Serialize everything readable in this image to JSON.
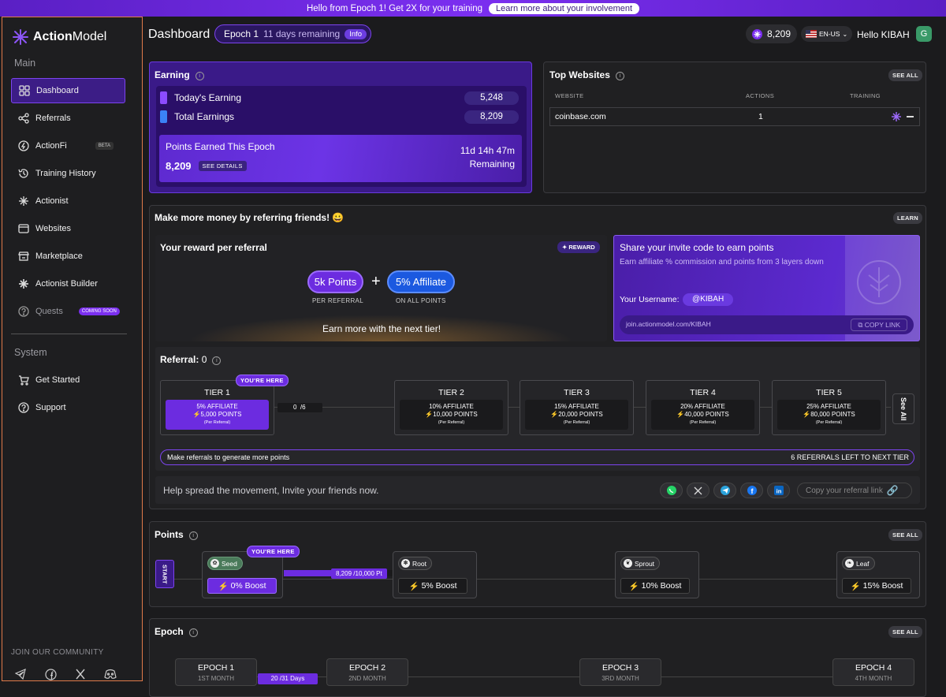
{
  "banner": {
    "message": "Hello from Epoch 1! Get 2X for your training",
    "cta": "Learn more about your involvement"
  },
  "brand": {
    "name_bold": "Action",
    "name_rest": "Model"
  },
  "sidebar": {
    "main_label": "Main",
    "items": [
      {
        "label": "Dashboard",
        "icon": "grid-icon"
      },
      {
        "label": "Referrals",
        "icon": "share-icon"
      },
      {
        "label": "ActionFi",
        "icon": "bolt-circle-icon",
        "badge": "BETA"
      },
      {
        "label": "Training History",
        "icon": "history-icon"
      },
      {
        "label": "Actionist",
        "icon": "logo-star-icon"
      },
      {
        "label": "Websites",
        "icon": "browser-icon"
      },
      {
        "label": "Marketplace",
        "icon": "store-icon"
      },
      {
        "label": "Actionist Builder",
        "icon": "builder-icon"
      },
      {
        "label": "Quests",
        "icon": "question-icon",
        "badge": "COMING SOON"
      }
    ],
    "system_label": "System",
    "system_items": [
      {
        "label": "Get Started",
        "icon": "cart-icon"
      },
      {
        "label": "Support",
        "icon": "help-icon"
      }
    ],
    "community_label": "JOIN OUR COMMUNITY"
  },
  "topbar": {
    "title": "Dashboard",
    "epoch_label": "Epoch 1",
    "epoch_remaining": "11 days remaining",
    "info_label": "Info",
    "points": "8,209",
    "language": "EN-US",
    "greeting": "Hello KIBAH",
    "avatar_letter": "G"
  },
  "earning": {
    "title": "Earning",
    "today_label": "Today's Earning",
    "today_value": "5,248",
    "total_label": "Total Earnings",
    "total_value": "8,209",
    "epoch_points_label": "Points Earned This Epoch",
    "epoch_points_value": "8,209",
    "see_details": "SEE DETAILS",
    "countdown": "11d 14h 47m",
    "remaining": "Remaining"
  },
  "top_websites": {
    "title": "Top Websites",
    "see_all": "SEE ALL",
    "columns": [
      "WEBSITE",
      "ACTIONS",
      "TRAINING"
    ],
    "rows": [
      {
        "website": "coinbase.com",
        "actions": "1"
      }
    ]
  },
  "referring": {
    "title": "Make more money by referring friends! 😀",
    "learn": "LEARN",
    "reward_title": "Your reward per referral",
    "reward_tag": "REWARD",
    "points_pill": "5k Points",
    "points_caption": "PER REFERRAL",
    "plus": "+",
    "affiliate_pill": "5% Affiliate",
    "affiliate_caption": "ON ALL POINTS",
    "earn_more": "Earn more with the next tier!",
    "share_title": "Share your invite code to earn points",
    "share_desc": "Earn affiliate % commission and points from 3 layers down",
    "username_label": "Your Username:",
    "username": "@KIBAH",
    "invite_link": "join.actionmodel.com/KIBAH",
    "copy_link": "COPY LINK"
  },
  "referral_tiers": {
    "title": "Referral:",
    "count": "0",
    "here": "YOU'RE HERE",
    "progress": "0",
    "progress_total": "/6",
    "see_all": "See All",
    "tiers": [
      {
        "name": "TIER 1",
        "affiliate": "5% AFFILIATE",
        "points": "5,000 POINTS",
        "note": "(Per Referral)"
      },
      {
        "name": "TIER 2",
        "affiliate": "10% AFFILIATE",
        "points": "10,000 POINTS",
        "note": "(Per Referral)"
      },
      {
        "name": "TIER 3",
        "affiliate": "15% AFFILIATE",
        "points": "20,000 POINTS",
        "note": "(Per Referral)"
      },
      {
        "name": "TIER 4",
        "affiliate": "20% AFFILIATE",
        "points": "40,000 POINTS",
        "note": "(Per Referral)"
      },
      {
        "name": "TIER 5",
        "affiliate": "25% AFFILIATE",
        "points": "80,000 POINTS",
        "note": "(Per Referral)"
      }
    ],
    "hint": "Make referrals to generate more points",
    "left": "6 REFERRALS LEFT TO NEXT TIER",
    "spread": "Help spread the movement, Invite your friends now.",
    "copy_referral": "Copy your referral link"
  },
  "points_section": {
    "title": "Points",
    "see_all": "SEE ALL",
    "start": "START",
    "here": "YOU'RE HERE",
    "progress": "8,209",
    "progress_total": "/10,000 Pt",
    "stages": [
      {
        "name": "Seed",
        "boost": "0% Boost"
      },
      {
        "name": "Root",
        "boost": "5% Boost"
      },
      {
        "name": "Sprout",
        "boost": "10% Boost"
      },
      {
        "name": "Leaf",
        "boost": "15% Boost"
      }
    ]
  },
  "epoch_section": {
    "title": "Epoch",
    "see_all": "SEE ALL",
    "progress": "20 /31 Days",
    "epochs": [
      {
        "name": "EPOCH 1",
        "sub": "1ST MONTH"
      },
      {
        "name": "EPOCH 2",
        "sub": "2ND MONTH"
      },
      {
        "name": "EPOCH 3",
        "sub": "3RD MONTH"
      },
      {
        "name": "EPOCH 4",
        "sub": "4TH MONTH"
      }
    ]
  },
  "colors": {
    "accent": "#7b2ff0",
    "accent_light": "#9b6bff",
    "blue": "#1b59e0",
    "highlight_border": "#e07a4a"
  }
}
